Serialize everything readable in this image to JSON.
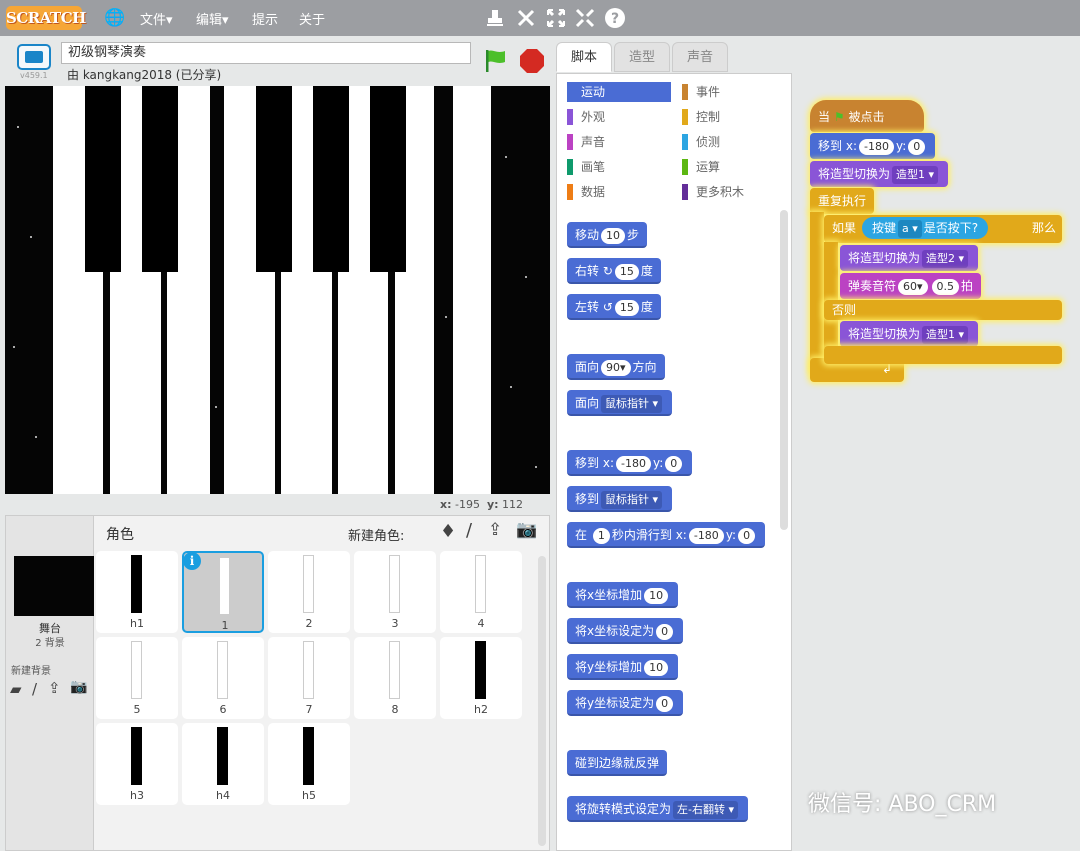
{
  "menu": {
    "logo": "SCRATCH",
    "file": "文件▾",
    "edit": "编辑▾",
    "tips": "提示",
    "about": "关于"
  },
  "stage": {
    "version": "v459.1",
    "title": "初级钢琴演奏",
    "author": "由 kangkang2018 (已分享)",
    "x_label": "x:",
    "x_value": "-195",
    "y_label": "y:",
    "y_value": "112"
  },
  "sprites": {
    "header": "角色",
    "new_sprite": "新建角色:",
    "stage_name": "舞台",
    "stage_sub": "2 背景",
    "new_backdrop": "新建背景",
    "items": [
      {
        "name": "h1",
        "black": true
      },
      {
        "name": "1",
        "black": false,
        "selected": true
      },
      {
        "name": "2",
        "black": false
      },
      {
        "name": "3",
        "black": false
      },
      {
        "name": "4",
        "black": false
      },
      {
        "name": "5",
        "black": false
      },
      {
        "name": "6",
        "black": false
      },
      {
        "name": "7",
        "black": false
      },
      {
        "name": "8",
        "black": false
      },
      {
        "name": "h2",
        "black": true
      },
      {
        "name": "h3",
        "black": true
      },
      {
        "name": "h4",
        "black": true
      },
      {
        "name": "h5",
        "black": true
      }
    ]
  },
  "tabs": {
    "scripts": "脚本",
    "costumes": "造型",
    "sounds": "声音"
  },
  "categories": {
    "motion": "运动",
    "looks": "外观",
    "sound": "声音",
    "pen": "画笔",
    "data": "数据",
    "events": "事件",
    "control": "控制",
    "sensing": "侦测",
    "operators": "运算",
    "more": "更多积木"
  },
  "palette": {
    "move": "移动",
    "move_n": "10",
    "move_unit": "步",
    "turn_r": "右转",
    "turn_r_n": "15",
    "turn_r_unit": "度",
    "turn_l": "左转",
    "turn_l_n": "15",
    "turn_l_unit": "度",
    "point": "面向",
    "point_n": "90▾",
    "point_unit": "方向",
    "point_to": "面向",
    "point_to_v": "鼠标指针 ▾",
    "goto": "移到",
    "goto_x_l": "x:",
    "goto_x": "-180",
    "goto_y_l": "y:",
    "goto_y": "0",
    "goto_to": "移到",
    "goto_to_v": "鼠标指针 ▾",
    "glide": "在",
    "glide_n": "1",
    "glide_text": "秒内滑行到",
    "glide_x_l": "x:",
    "glide_x": "-180",
    "glide_y_l": "y:",
    "glide_y": "0",
    "chx": "将x坐标增加",
    "chx_n": "10",
    "setx": "将x坐标设定为",
    "setx_n": "0",
    "chy": "将y坐标增加",
    "chy_n": "10",
    "sety": "将y坐标设定为",
    "sety_n": "0",
    "bounce": "碰到边缘就反弹",
    "rot": "将旋转模式设定为",
    "rot_v": "左-右翻转 ▾"
  },
  "script": {
    "hat_when": "当",
    "hat_clicked": "被点击",
    "goto": "移到",
    "goto_x_l": "x:",
    "goto_x": "-180",
    "goto_y_l": "y:",
    "goto_y": "0",
    "costume1": "将造型切换为",
    "costume1_v": "造型1 ▾",
    "forever": "重复执行",
    "if": "如果",
    "key": "按键",
    "key_v": "a ▾",
    "pressed": "是否按下?",
    "then": "那么",
    "costume2": "将造型切换为",
    "costume2_v": "造型2 ▾",
    "play": "弹奏音符",
    "note": "60▾",
    "beats": "0.5",
    "beat_unit": "拍",
    "else": "否则",
    "costume3": "将造型切换为",
    "costume3_v": "造型1 ▾",
    "loop_arrow": "↲"
  },
  "watermark": "微信号: ABO_CRM"
}
